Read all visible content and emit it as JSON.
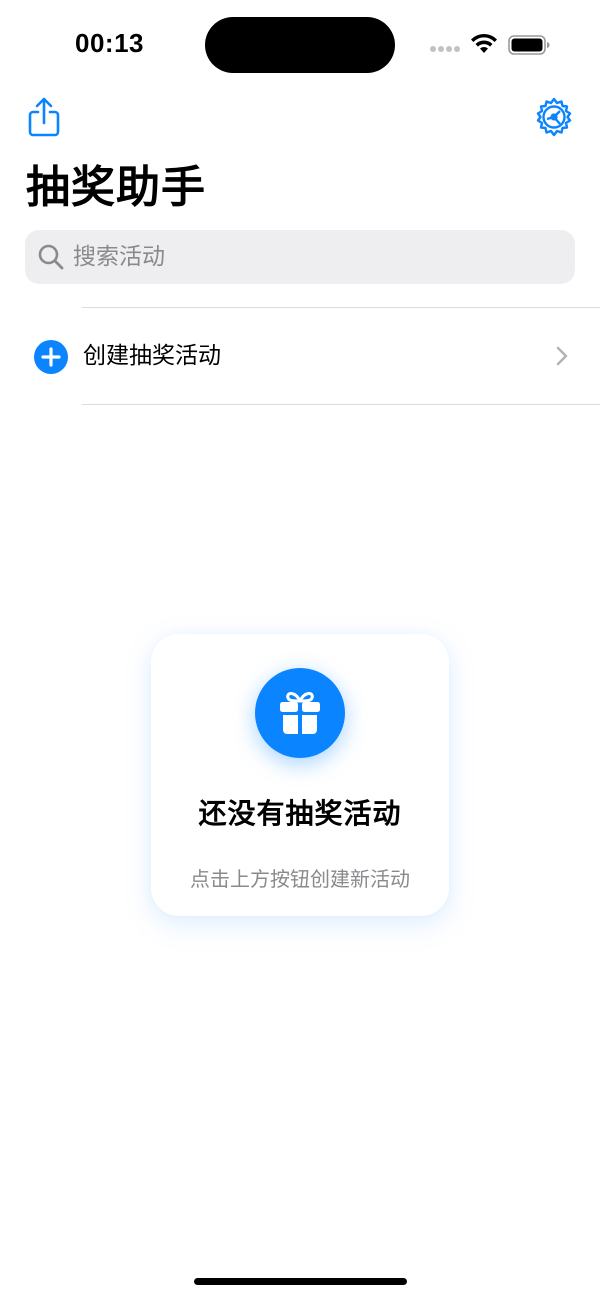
{
  "status_bar": {
    "time": "00:13"
  },
  "nav": {
    "share_icon": "share-icon",
    "settings_icon": "gear-icon"
  },
  "page": {
    "title": "抽奖助手"
  },
  "search": {
    "placeholder": "搜索活动",
    "value": ""
  },
  "list": {
    "create_label": "创建抽奖活动",
    "create_icon": "plus-circle-icon",
    "chevron_icon": "chevron-right-icon"
  },
  "empty_state": {
    "icon": "gift-icon",
    "title": "还没有抽奖活动",
    "subtitle": "点击上方按钮创建新活动"
  },
  "colors": {
    "accent": "#0a84ff",
    "secondary_text": "#8a8a8e",
    "search_bg": "#eeeef0"
  }
}
